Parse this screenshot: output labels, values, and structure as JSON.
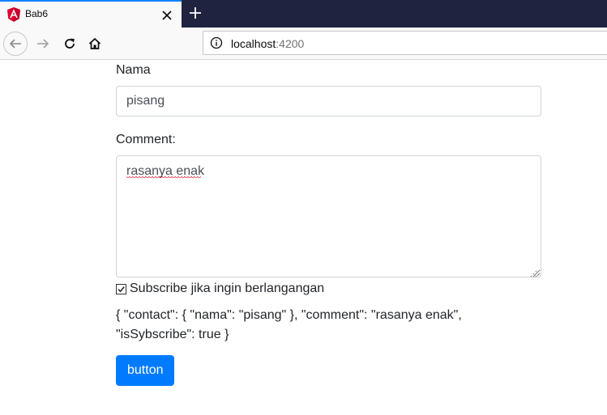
{
  "browser": {
    "tab": {
      "title": "Bab6",
      "favicon": "angular-icon"
    },
    "url": {
      "host": "localhost",
      "port": ":4200"
    }
  },
  "form": {
    "nama_label": "Nama",
    "nama_value": "pisang",
    "comment_label": "Comment:",
    "comment_value": "rasanya enak",
    "subscribe_label": "Subscribe jika ingin berlangangan",
    "subscribe_checked": true,
    "json_output": "{ \"contact\": { \"nama\": \"pisang\" }, \"comment\": \"rasanya enak\", \"isSybscribe\": true }",
    "button_label": "button"
  },
  "colors": {
    "tabbar_bg": "#202340",
    "tab_accent": "#0a84ff",
    "button_primary": "#007bff",
    "angular_red": "#dd0031"
  }
}
